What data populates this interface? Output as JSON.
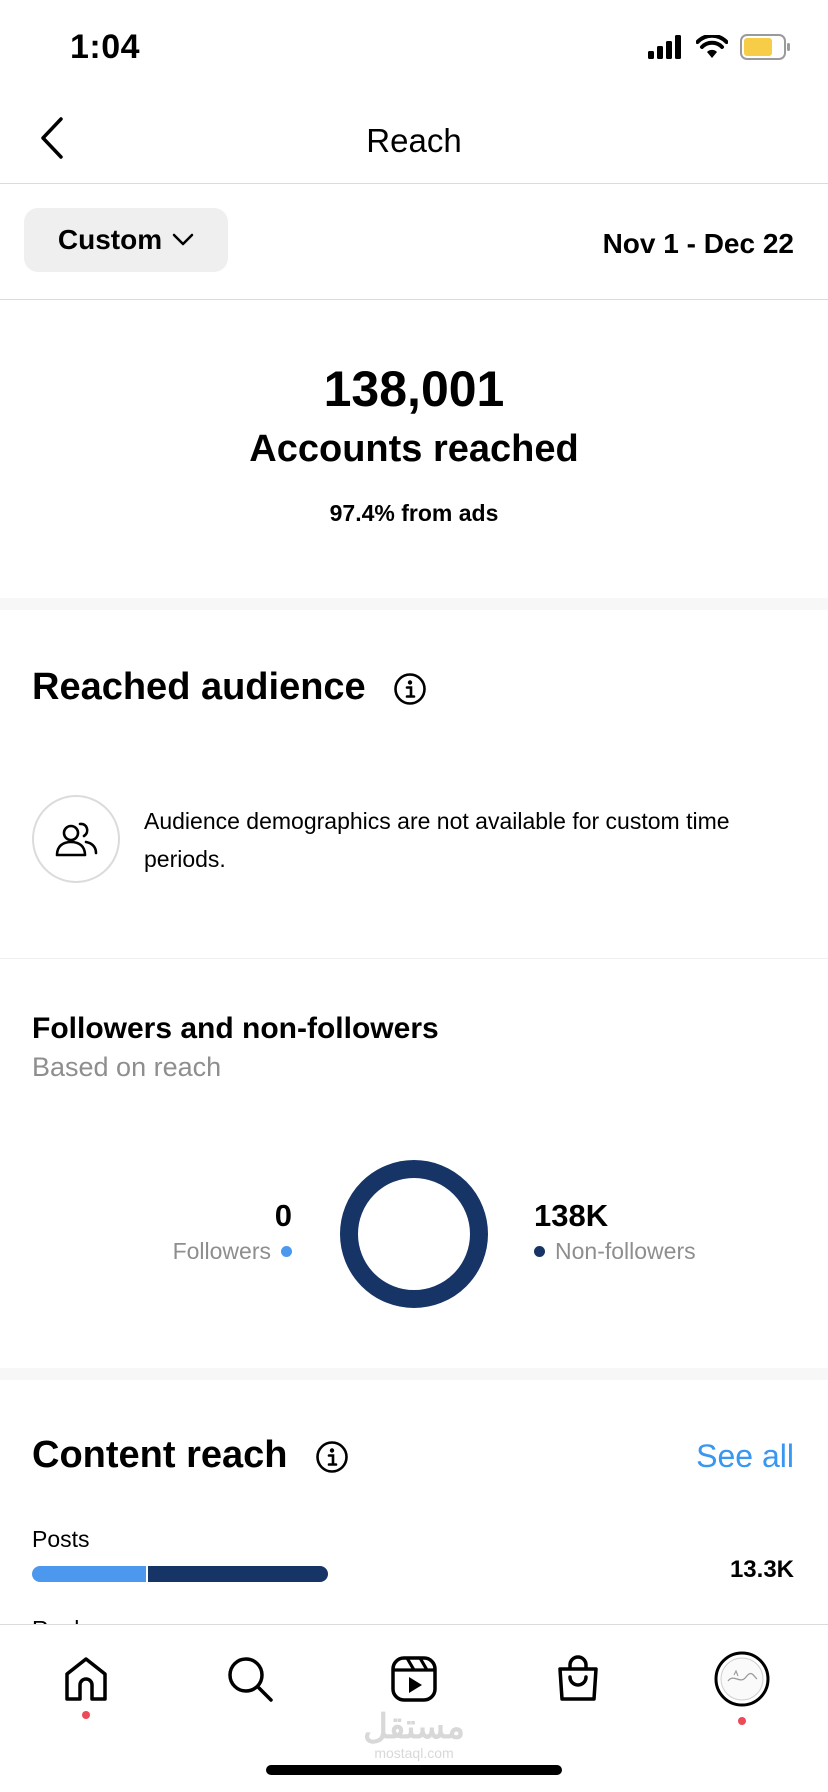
{
  "status_bar": {
    "time": "1:04",
    "icons": [
      "signal-icon",
      "wifi-icon",
      "battery-icon"
    ],
    "battery_color": "#f7cc46"
  },
  "nav": {
    "title": "Reach",
    "back_icon": "chevron-left-icon"
  },
  "filter": {
    "custom_label": "Custom",
    "date_range": "Nov 1 - Dec 22"
  },
  "summary": {
    "value": "138,001",
    "label": "Accounts reached",
    "sub": "97.4% from ads"
  },
  "reached_audience": {
    "title": "Reached audience",
    "message": "Audience demographics are not available for custom time periods."
  },
  "followers": {
    "title": "Followers and non-followers",
    "subtitle": "Based on reach",
    "followers_value": "0",
    "followers_label": "Followers",
    "non_followers_value": "138K",
    "non_followers_label": "Non-followers",
    "followers_fraction": 0.0,
    "colors": {
      "followers": "#4c98ee",
      "non_followers": "#163466"
    }
  },
  "content_reach": {
    "title": "Content reach",
    "see_all": "See all",
    "posts_label": "Posts",
    "posts_value": "13.3K",
    "next_label_partial": "Reels"
  },
  "tab_bar": {
    "tabs": [
      "home-icon",
      "search-icon",
      "reels-icon",
      "shop-icon",
      "profile-avatar"
    ]
  },
  "watermark": {
    "arabic": "مستقل",
    "latin": "mostaql.com"
  },
  "accent_color": "#3897f0"
}
